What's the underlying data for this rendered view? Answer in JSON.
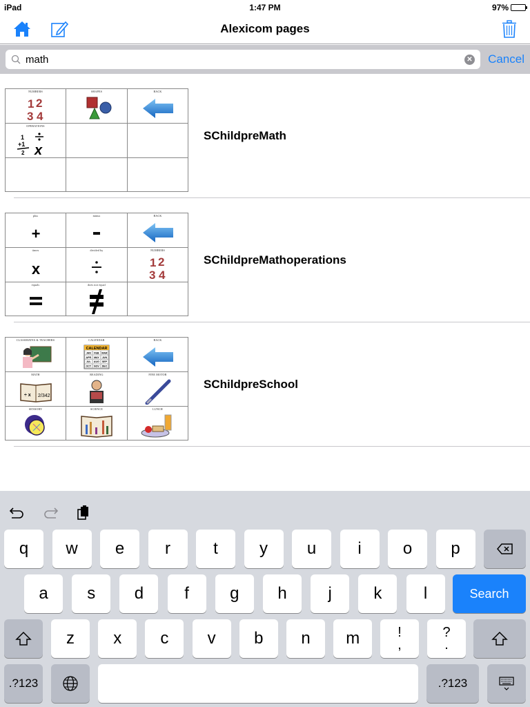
{
  "status_bar": {
    "device": "iPad",
    "time": "1:47 PM",
    "battery": "97%",
    "battery_level": 0.97
  },
  "nav": {
    "title": "Alexicom pages",
    "icons": [
      "home-icon",
      "edit-icon",
      "trash-icon"
    ]
  },
  "search": {
    "value": "math",
    "placeholder": "Search",
    "cancel_label": "Cancel"
  },
  "results": [
    {
      "title": "SChildpreMath",
      "cells": [
        {
          "label": "NUMBERS",
          "image": "numbers"
        },
        {
          "label": "SHAPES",
          "image": "shapes"
        },
        {
          "label": "BACK",
          "image": "back-arrow"
        },
        {
          "label": "OPERATIONS",
          "image": "operations"
        },
        {
          "label": "",
          "image": ""
        },
        {
          "label": "",
          "image": ""
        },
        {
          "label": "",
          "image": ""
        },
        {
          "label": "",
          "image": ""
        },
        {
          "label": "",
          "image": ""
        }
      ]
    },
    {
      "title": "SChildpreMathoperations",
      "cells": [
        {
          "label": "plus",
          "image": "plus"
        },
        {
          "label": "minus",
          "image": "minus"
        },
        {
          "label": "BACK",
          "image": "back-arrow"
        },
        {
          "label": "times",
          "image": "times"
        },
        {
          "label": "divided by",
          "image": "divide"
        },
        {
          "label": "NUMBERS",
          "image": "numbers"
        },
        {
          "label": "equals",
          "image": "equals"
        },
        {
          "label": "does not equal",
          "image": "not-equal"
        },
        {
          "label": "",
          "image": ""
        }
      ]
    },
    {
      "title": "SChildpreSchool",
      "cells": [
        {
          "label": "CLASSMATES & TEACHERS",
          "image": "teacher"
        },
        {
          "label": "CALENDAR",
          "image": "calendar"
        },
        {
          "label": "BACK",
          "image": "back-arrow"
        },
        {
          "label": "MATH",
          "image": "math-book"
        },
        {
          "label": "READING",
          "image": "reading"
        },
        {
          "label": "FINE MOTOR",
          "image": "pen"
        },
        {
          "label": "SENSORY",
          "image": "sensory"
        },
        {
          "label": "SCIENCE",
          "image": "science"
        },
        {
          "label": "LUNCH",
          "image": "lunch"
        }
      ]
    }
  ],
  "calendar_months": [
    "JAN",
    "FEB",
    "MAR",
    "APR",
    "MAY",
    "JUN",
    "JUL",
    "AUG",
    "SEP",
    "OCT",
    "NOV",
    "DEC"
  ],
  "calendar_title": "CALENDAR",
  "keyboard": {
    "toolbar": [
      "undo-icon",
      "redo-icon",
      "paste-icon"
    ],
    "row1": [
      "q",
      "w",
      "e",
      "r",
      "t",
      "y",
      "u",
      "i",
      "o",
      "p"
    ],
    "row2": [
      "a",
      "s",
      "d",
      "f",
      "g",
      "h",
      "j",
      "k",
      "l"
    ],
    "row3": [
      "z",
      "x",
      "c",
      "v",
      "b",
      "n",
      "m"
    ],
    "punct1": {
      "top": "!",
      "bottom": ","
    },
    "punct2": {
      "top": "?",
      "bottom": "."
    },
    "search_label": "Search",
    "numbers_label": ".?123",
    "accent_color": "#1a82fb"
  }
}
